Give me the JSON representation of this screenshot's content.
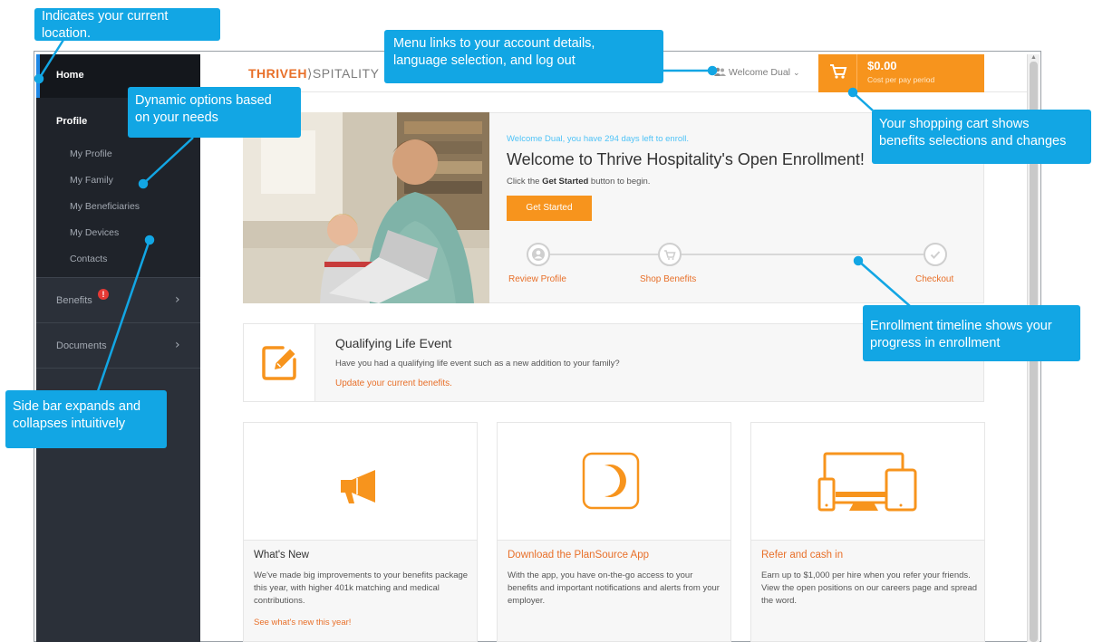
{
  "brand": {
    "name_part1": "THRIVEH",
    "name_part2": "SPITALITY",
    "accent": "#e8702a",
    "cart_orange": "#f7941d"
  },
  "sidebar": {
    "home": "Home",
    "profile": "Profile",
    "profile_items": [
      "My Profile",
      "My Family",
      "My Beneficiaries",
      "My Devices",
      "Contacts"
    ],
    "benefits": "Benefits",
    "benefits_alert": "!",
    "documents": "Documents"
  },
  "header": {
    "welcome_menu": "Welcome Dual",
    "cart_amount": "$0.00",
    "cart_caption": "Cost per pay period"
  },
  "hero": {
    "days_left": "Welcome Dual, you have 294 days left to enroll.",
    "title": "Welcome to Thrive Hospitality's Open Enrollment!",
    "sub_pre": "Click the ",
    "sub_bold": "Get Started",
    "sub_post": " button to begin.",
    "button": "Get Started",
    "steps": [
      "Review Profile",
      "Shop Benefits",
      "Checkout"
    ]
  },
  "qle": {
    "title": "Qualifying Life Event",
    "desc": "Have you had a qualifying life event such as a new addition to your family?",
    "link": "Update your current benefits."
  },
  "cards": [
    {
      "icon": "megaphone-icon",
      "title": "What's New",
      "body": "We've made big improvements to your benefits package this year, with higher 401k matching and medical contributions.",
      "link": "See what's new this year!"
    },
    {
      "icon": "planSource-app-icon",
      "title": "Download the PlanSource App",
      "body": "With the app, you have on-the-go access to your benefits and important notifications and alerts from your employer.",
      "link": ""
    },
    {
      "icon": "devices-icon",
      "title": "Refer and cash in",
      "body": "Earn up to $1,000 per hire when you refer your friends. View the open positions on our careers page and spread the word.",
      "link": ""
    }
  ],
  "callouts": {
    "location": "Indicates your current\nlocation.",
    "menu": "Menu links to your account details,\nlanguage selection, and log out",
    "dynamic": "Dynamic options based\non your needs",
    "cart": "Your shopping cart shows\nbenefits selections and changes",
    "timeline": "Enrollment timeline shows your\nprogress in enrollment",
    "sidebar": "Side bar expands and\ncollapses intuitively"
  }
}
